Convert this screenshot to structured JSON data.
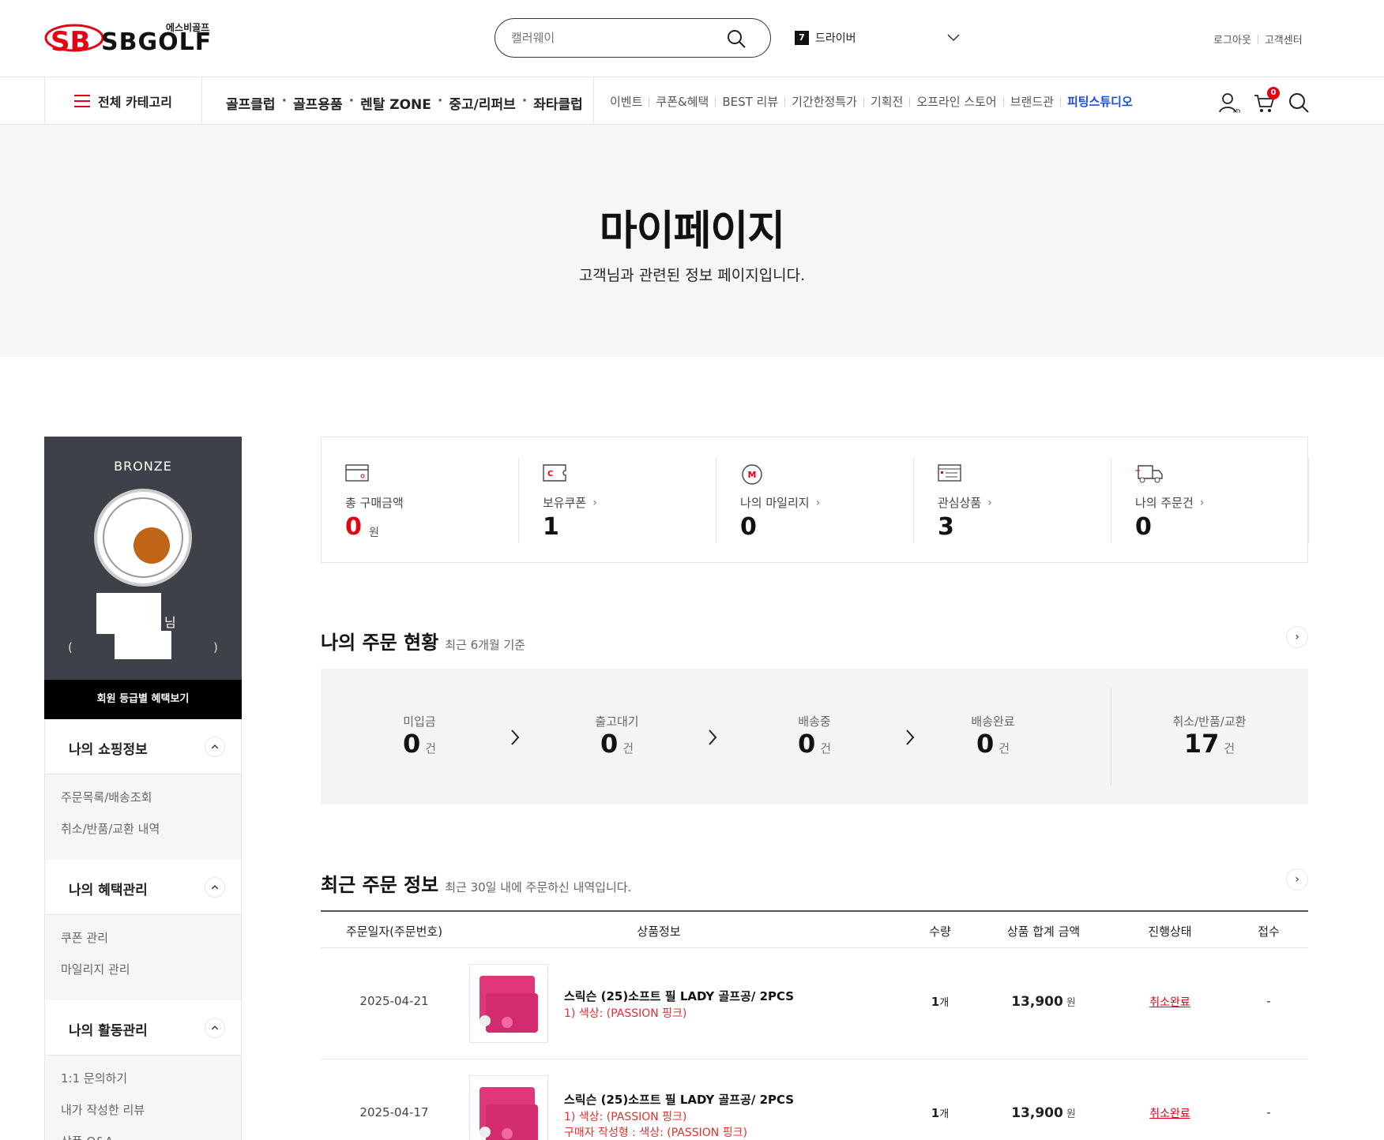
{
  "header": {
    "logo_sub": "에스비골프",
    "logo_text": "SBGOLF",
    "search_placeholder": "캘러웨이",
    "rank_num": "7",
    "rank_keyword": "드라이버",
    "util": [
      "로그아웃",
      "고객센터"
    ]
  },
  "nav": {
    "all_category": "전체 카테고리",
    "main": [
      "골프클럽",
      "골프용품",
      "렌탈 ZONE",
      "중고/리퍼브",
      "좌타클럽"
    ],
    "sub": [
      "이벤트",
      "쿠폰&혜택",
      "BEST 리뷰",
      "기간한정특가",
      "기획전",
      "오프라인 스토어",
      "브랜드관",
      "피팅스튜디오"
    ],
    "cart_count": "0"
  },
  "hero": {
    "title": "마이페이지",
    "subtitle": "고객님과 관련된 정보 페이지입니다."
  },
  "sidebar": {
    "grade": "BRONZE",
    "name_suffix": "님",
    "paren_open": "(",
    "paren_close": ")",
    "grade_button": "회원 등급별 혜택보기",
    "sections": [
      {
        "title": "나의 쇼핑정보",
        "items": [
          "주문목록/배송조회",
          "취소/반품/교환 내역"
        ]
      },
      {
        "title": "나의 혜택관리",
        "items": [
          "쿠폰 관리",
          "마일리지 관리"
        ]
      },
      {
        "title": "나의 활동관리",
        "items": [
          "1:1 문의하기",
          "내가 작성한 리뷰",
          "상품 Q&A"
        ]
      }
    ]
  },
  "stats": [
    {
      "label": "총 구매금액",
      "value": "0",
      "unit": "원",
      "arrow": ""
    },
    {
      "label": "보유쿠폰",
      "value": "1",
      "unit": "",
      "arrow": "›"
    },
    {
      "label": "나의 마일리지",
      "value": "0",
      "unit": "",
      "arrow": "›"
    },
    {
      "label": "관심상품",
      "value": "3",
      "unit": "",
      "arrow": "›"
    },
    {
      "label": "나의 주문건",
      "value": "0",
      "unit": "",
      "arrow": "›"
    }
  ],
  "order_status": {
    "title": "나의 주문 현황",
    "note": "최근 6개월 기준",
    "unit": "건",
    "items": [
      {
        "label": "미입금",
        "value": "0"
      },
      {
        "label": "출고대기",
        "value": "0"
      },
      {
        "label": "배송중",
        "value": "0"
      },
      {
        "label": "배송완료",
        "value": "0"
      },
      {
        "label": "취소/반품/교환",
        "value": "17"
      }
    ]
  },
  "recent_orders": {
    "title": "최근 주문 정보",
    "note": "최근 30일 내에 주문하신 내역입니다.",
    "columns": [
      "주문일자(주문번호)",
      "상품정보",
      "수량",
      "상품 합계 금액",
      "진행상태",
      "접수"
    ],
    "rows": [
      {
        "date": "2025-04-21",
        "name": "스릭슨 (25)소프트 필 LADY 골프공/ 2PCS",
        "option": "1) 색상: (PASSION 핑크)",
        "option2": "",
        "qty": "1",
        "qty_unit": "개",
        "amount": "13,900",
        "amount_unit": "원",
        "status": "취소완료",
        "receipt": "-"
      },
      {
        "date": "2025-04-17",
        "name": "스릭슨 (25)소프트 필 LADY 골프공/ 2PCS",
        "option": "1) 색상: (PASSION 핑크)",
        "option2": "구매자 작성형 : 색상: (PASSION 핑크)",
        "qty": "1",
        "qty_unit": "개",
        "amount": "13,900",
        "amount_unit": "원",
        "status": "취소완료",
        "receipt": "-"
      }
    ]
  },
  "colors": {
    "brand_red": "#e60012",
    "sidebar_dark": "#3f4148",
    "accent_blue": "#1a4fd6",
    "avatar_ball": "#c06418"
  }
}
